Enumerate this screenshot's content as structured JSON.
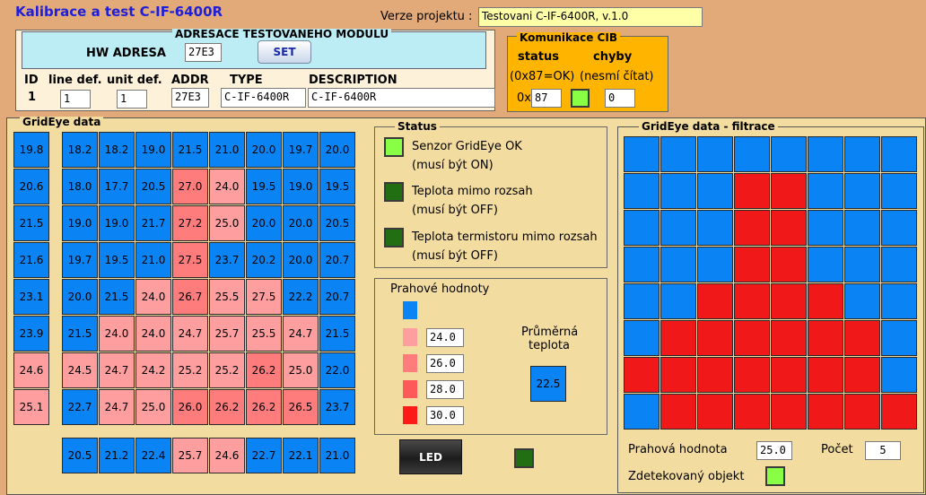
{
  "app": {
    "title": "Kalibrace a test C-IF-6400R"
  },
  "project": {
    "label": "Verze projektu :",
    "value": "Testovani C-IF-6400R, v.1.0"
  },
  "module": {
    "group_title": "ADRESACE TESTOVANEHO MODULU",
    "hw_label": "HW ADRESA",
    "hw_value": "27E3",
    "set_label": "SET",
    "headers": [
      "ID",
      "line def.",
      "unit def.",
      "ADDR",
      "TYPE",
      "DESCRIPTION"
    ],
    "row": {
      "id": "1",
      "line": "1",
      "unit": "1",
      "addr": "27E3",
      "type": "C-IF-6400R",
      "description": "C-IF-6400R"
    }
  },
  "cib": {
    "group_title": "Komunikace CIB",
    "status_label": "status",
    "chyby_label": "chyby",
    "status_hint": "(0x87=OK)",
    "chyby_hint": "(nesmí čítat)",
    "prefix": "0x",
    "status_value": "87",
    "errors_value": "0",
    "indicator_color": "#88ff44"
  },
  "grideye": {
    "group_title": "GridEye data",
    "first_column": [
      "19.8",
      "20.6",
      "21.5",
      "21.6",
      "23.1",
      "23.9",
      "24.6",
      "25.1"
    ],
    "first_column_levels": [
      0,
      0,
      0,
      0,
      0,
      0,
      1,
      1
    ],
    "rows": [
      [
        "18.2",
        "18.2",
        "19.0",
        "21.5",
        "21.0",
        "20.0",
        "19.7",
        "20.0"
      ],
      [
        "18.0",
        "17.7",
        "20.5",
        "27.0",
        "24.0",
        "19.5",
        "19.0",
        "19.5"
      ],
      [
        "19.0",
        "19.0",
        "21.7",
        "27.2",
        "25.0",
        "20.0",
        "20.0",
        "20.5"
      ],
      [
        "19.7",
        "19.5",
        "21.0",
        "27.5",
        "23.7",
        "20.2",
        "20.0",
        "20.7"
      ],
      [
        "20.0",
        "21.5",
        "24.0",
        "26.7",
        "25.5",
        "27.5",
        "22.2",
        "20.7"
      ],
      [
        "21.5",
        "24.0",
        "24.0",
        "24.7",
        "25.7",
        "25.5",
        "24.7",
        "21.5"
      ],
      [
        "24.5",
        "24.7",
        "24.2",
        "25.2",
        "25.2",
        "26.2",
        "25.0",
        "22.0"
      ],
      [
        "22.7",
        "24.7",
        "25.0",
        "26.0",
        "26.2",
        "26.2",
        "26.5",
        "23.7"
      ]
    ],
    "levels": [
      [
        0,
        0,
        0,
        0,
        0,
        0,
        0,
        0
      ],
      [
        0,
        0,
        0,
        2,
        1,
        0,
        0,
        0
      ],
      [
        0,
        0,
        0,
        2,
        1,
        0,
        0,
        0
      ],
      [
        0,
        0,
        0,
        2,
        0,
        0,
        0,
        0
      ],
      [
        0,
        0,
        1,
        2,
        1,
        1,
        0,
        0
      ],
      [
        0,
        1,
        1,
        1,
        1,
        1,
        1,
        0
      ],
      [
        1,
        1,
        1,
        1,
        1,
        2,
        1,
        0
      ],
      [
        0,
        1,
        1,
        2,
        2,
        2,
        2,
        0
      ]
    ],
    "bottom_row": [
      "20.5",
      "21.2",
      "22.4",
      "25.7",
      "24.6",
      "22.7",
      "22.1",
      "21.0"
    ],
    "bottom_levels": [
      0,
      0,
      0,
      1,
      1,
      0,
      0,
      0
    ]
  },
  "status": {
    "group_title": "Status",
    "items": [
      {
        "label": "Senzor GridEye OK",
        "hint": "(musí být ON)",
        "state": "on"
      },
      {
        "label": "Teplota mimo rozsah",
        "hint": "(musí být OFF)",
        "state": "off"
      },
      {
        "label": "Teplota termistoru mimo rozsah",
        "hint": "(musí být OFF)",
        "state": "off"
      }
    ]
  },
  "thresholds": {
    "title": "Prahové hodnoty",
    "values": [
      "24.0",
      "26.0",
      "28.0",
      "30.0"
    ],
    "colors": [
      "#0a84f4",
      "#ff9e9e",
      "#ff7c7c",
      "#ff5a5a",
      "#ff1a1a"
    ],
    "avg_label_1": "Průměrná",
    "avg_label_2": "teplota",
    "avg_value": "22.5"
  },
  "led": {
    "button_label": "LED",
    "state": "off"
  },
  "filtered": {
    "group_title": "GridEye data - filtrace",
    "grid": [
      [
        0,
        0,
        0,
        0,
        0,
        0,
        0,
        0
      ],
      [
        0,
        0,
        0,
        1,
        1,
        0,
        0,
        0
      ],
      [
        0,
        0,
        0,
        1,
        1,
        0,
        0,
        0
      ],
      [
        0,
        0,
        0,
        1,
        1,
        0,
        0,
        0
      ],
      [
        0,
        0,
        1,
        1,
        1,
        1,
        0,
        0
      ],
      [
        0,
        1,
        1,
        1,
        1,
        1,
        1,
        0
      ],
      [
        1,
        1,
        1,
        1,
        1,
        1,
        1,
        0
      ],
      [
        0,
        1,
        1,
        1,
        1,
        1,
        1,
        1
      ]
    ],
    "threshold_label": "Prahová hodnota",
    "threshold_value": "25.0",
    "count_label": "Počet",
    "count_value": "5",
    "detected_label": "Zdetekovaný objekt",
    "detected_state": "on"
  }
}
